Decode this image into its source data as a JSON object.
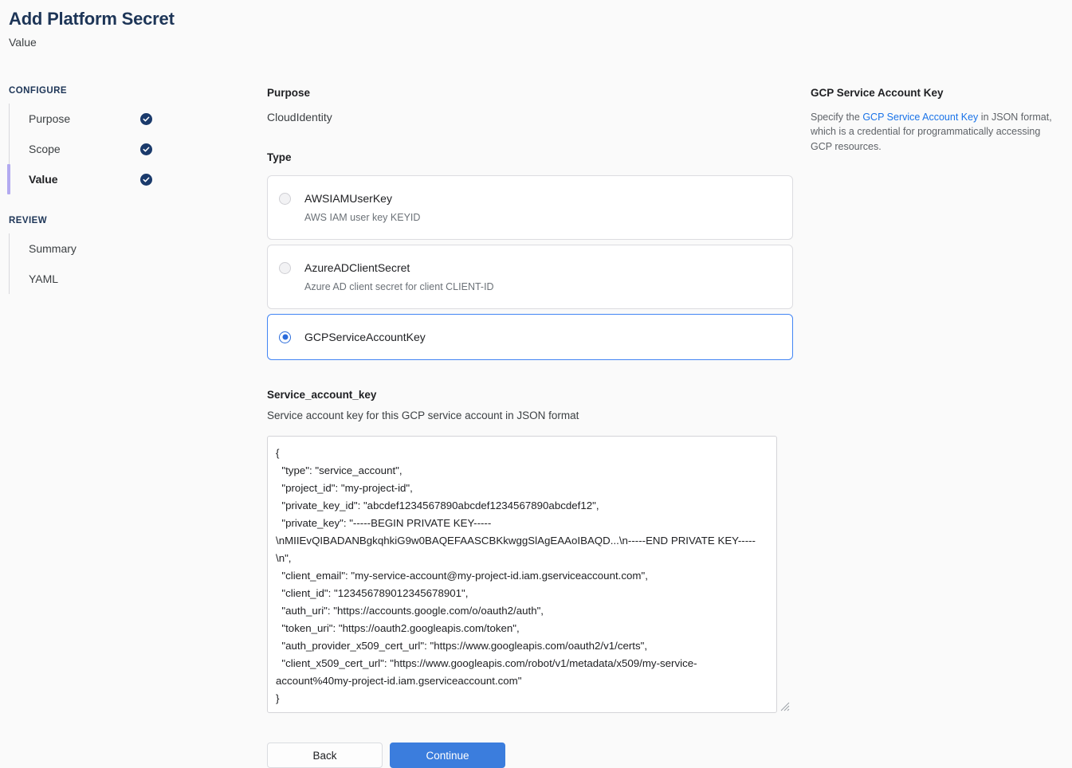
{
  "header": {
    "title": "Add Platform Secret",
    "subtitle": "Value"
  },
  "sidebar": {
    "sections": [
      {
        "title": "CONFIGURE",
        "items": [
          {
            "label": "Purpose",
            "completed": true,
            "active": false
          },
          {
            "label": "Scope",
            "completed": true,
            "active": false
          },
          {
            "label": "Value",
            "completed": true,
            "active": true
          }
        ]
      },
      {
        "title": "REVIEW",
        "items": [
          {
            "label": "Summary",
            "completed": false,
            "active": false
          },
          {
            "label": "YAML",
            "completed": false,
            "active": false
          }
        ]
      }
    ]
  },
  "main": {
    "purpose": {
      "label": "Purpose",
      "value": "CloudIdentity"
    },
    "type": {
      "label": "Type",
      "options": [
        {
          "title": "AWSIAMUserKey",
          "description": "AWS IAM user key KEYID",
          "selected": false
        },
        {
          "title": "AzureADClientSecret",
          "description": "Azure AD client secret for client CLIENT-ID",
          "selected": false
        },
        {
          "title": "GCPServiceAccountKey",
          "description": "",
          "selected": true
        }
      ]
    },
    "service_account_key": {
      "label": "Service_account_key",
      "description": "Service account key for this GCP service account in JSON format",
      "value": "{\n  \"type\": \"service_account\",\n  \"project_id\": \"my-project-id\",\n  \"private_key_id\": \"abcdef1234567890abcdef1234567890abcdef12\",\n  \"private_key\": \"-----BEGIN PRIVATE KEY-----\\nMIIEvQIBADANBgkqhkiG9w0BAQEFAASCBKkwggSlAgEAAoIBAQD...\\n-----END PRIVATE KEY-----\\n\",\n  \"client_email\": \"my-service-account@my-project-id.iam.gserviceaccount.com\",\n  \"client_id\": \"123456789012345678901\",\n  \"auth_uri\": \"https://accounts.google.com/o/oauth2/auth\",\n  \"token_uri\": \"https://oauth2.googleapis.com/token\",\n  \"auth_provider_x509_cert_url\": \"https://www.googleapis.com/oauth2/v1/certs\",\n  \"client_x509_cert_url\": \"https://www.googleapis.com/robot/v1/metadata/x509/my-service-account%40my-project-id.iam.gserviceaccount.com\"\n}"
    },
    "buttons": {
      "back": "Back",
      "continue": "Continue"
    }
  },
  "help": {
    "title": "GCP Service Account Key",
    "text_before": "Specify the ",
    "link": "GCP Service Account Key",
    "text_after": " in JSON format, which is a credential for programmatically accessing GCP resources."
  },
  "colors": {
    "accent": "#3b7ddd",
    "title": "#1d3557",
    "active_marker": "#b3aaf0",
    "check_badge": "#1a3a6b",
    "link": "#1a73e8"
  }
}
